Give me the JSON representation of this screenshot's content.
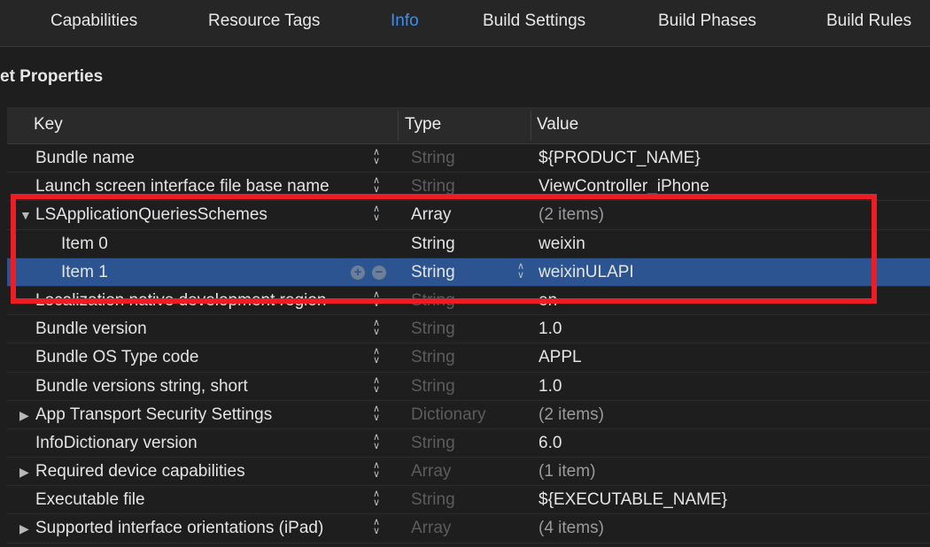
{
  "tabs": [
    "Capabilities",
    "Resource Tags",
    "Info",
    "Build Settings",
    "Build Phases",
    "Build Rules"
  ],
  "active_tab": "Info",
  "section_title": "et Properties",
  "columns": {
    "key": "Key",
    "type": "Type",
    "value": "Value"
  },
  "rows": [
    {
      "key": "Bundle name",
      "type": "String",
      "value": "${PRODUCT_NAME}",
      "type_dim": true,
      "value_dim": false
    },
    {
      "key": "Launch screen interface file base name",
      "type": "String",
      "value": "ViewController_iPhone",
      "type_dim": true,
      "value_dim": false
    },
    {
      "key": "LSApplicationQueriesSchemes",
      "type": "Array",
      "value": "(2 items)",
      "type_dim": false,
      "value_dim": true,
      "expanded": true
    },
    {
      "key": "Item 0",
      "type": "String",
      "value": "weixin",
      "type_dim": false,
      "value_dim": false,
      "child": true
    },
    {
      "key": "Item 1",
      "type": "String",
      "value": "weixinULAPI",
      "type_dim": false,
      "value_dim": false,
      "child": true,
      "selected": true
    },
    {
      "key": "Localization native development region",
      "type": "String",
      "value": "en",
      "type_dim": true,
      "value_dim": false
    },
    {
      "key": "Bundle version",
      "type": "String",
      "value": "1.0",
      "type_dim": true,
      "value_dim": false
    },
    {
      "key": "Bundle OS Type code",
      "type": "String",
      "value": "APPL",
      "type_dim": true,
      "value_dim": false
    },
    {
      "key": "Bundle versions string, short",
      "type": "String",
      "value": "1.0",
      "type_dim": true,
      "value_dim": false
    },
    {
      "key": "App Transport Security Settings",
      "type": "Dictionary",
      "value": "(2 items)",
      "type_dim": true,
      "value_dim": true,
      "collapsed": true
    },
    {
      "key": "InfoDictionary version",
      "type": "String",
      "value": "6.0",
      "type_dim": true,
      "value_dim": false
    },
    {
      "key": "Required device capabilities",
      "type": "Array",
      "value": "(1 item)",
      "type_dim": true,
      "value_dim": true,
      "collapsed": true
    },
    {
      "key": "Executable file",
      "type": "String",
      "value": "${EXECUTABLE_NAME}",
      "type_dim": true,
      "value_dim": false
    },
    {
      "key": "Supported interface orientations (iPad)",
      "type": "Array",
      "value": "(4 items)",
      "type_dim": true,
      "value_dim": true,
      "collapsed": true
    }
  ],
  "icons": {
    "expanded": "disclosure-triangle-down",
    "collapsed": "disclosure-triangle-right",
    "stepper": "up-down-chevron",
    "add": "plus-circle",
    "remove": "minus-circle"
  },
  "colors": {
    "accent": "#3a8ff7",
    "selection": "#2b5490",
    "annotation_box": "#ee1c25"
  }
}
